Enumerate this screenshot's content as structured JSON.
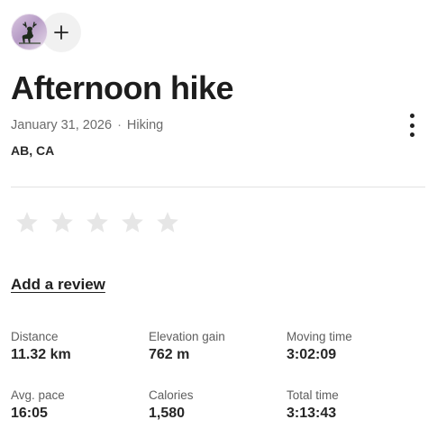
{
  "header": {
    "avatar_icon": "deer-icon",
    "add_icon": "plus-icon"
  },
  "activity": {
    "title": "Afternoon hike",
    "date": "January 31, 2026",
    "separator": "·",
    "type": "Hiking",
    "location": "AB, CA",
    "more_icon": "more-vertical-icon"
  },
  "rating": {
    "stars": 5,
    "selected": 0,
    "star_color": "#e6e6e6"
  },
  "review": {
    "link_label": "Add a review"
  },
  "stats": [
    {
      "label": "Distance",
      "value": "11.32 km"
    },
    {
      "label": "Elevation gain",
      "value": "762 m"
    },
    {
      "label": "Moving time",
      "value": "3:02:09"
    },
    {
      "label": "Avg. pace",
      "value": "16:05"
    },
    {
      "label": "Calories",
      "value": "1,580"
    },
    {
      "label": "Total time",
      "value": "3:13:43"
    }
  ]
}
